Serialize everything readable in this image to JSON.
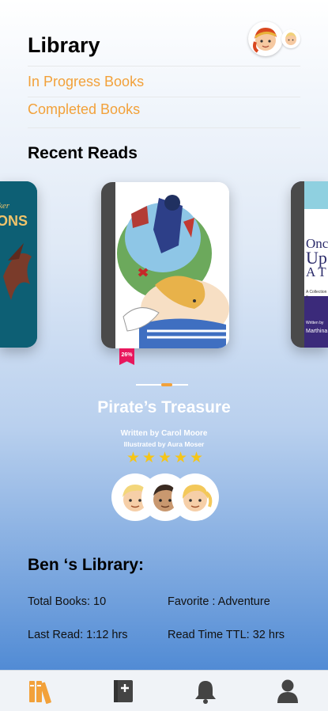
{
  "header": {
    "title": "Library"
  },
  "menu": {
    "in_progress": "In Progress Books",
    "completed": "Completed Books"
  },
  "recent": {
    "title": "Recent Reads",
    "left_book_fragment": "ker of\nONS",
    "right_book_fragment_1": "Onc",
    "right_book_fragment_2": "Up",
    "right_book_fragment_3": "A T",
    "right_book_caption": "A Collection o",
    "right_book_written": "Written by",
    "right_book_author": "Marthina",
    "bookmark_progress": "26%"
  },
  "featured": {
    "title": "Pirate’s Treasure",
    "written_by": "Written by Carol Moore",
    "illustrated_by": "Illustrated by Aura Moser",
    "rating": 5
  },
  "library": {
    "title": "Ben ‘s Library:",
    "total_books": "Total Books: 10",
    "favorite": "Favorite :  Adventure",
    "last_read": "Last Read: 1:12 hrs",
    "read_time": "Read Time TTL: 32 hrs"
  },
  "tabs": [
    {
      "icon": "books-icon",
      "active": true
    },
    {
      "icon": "add-book-icon",
      "active": false
    },
    {
      "icon": "bell-icon",
      "active": false
    },
    {
      "icon": "profile-icon",
      "active": false
    }
  ],
  "colors": {
    "accent": "#f2a13a",
    "bookmark": "#e8175d",
    "star": "#f5c518"
  }
}
